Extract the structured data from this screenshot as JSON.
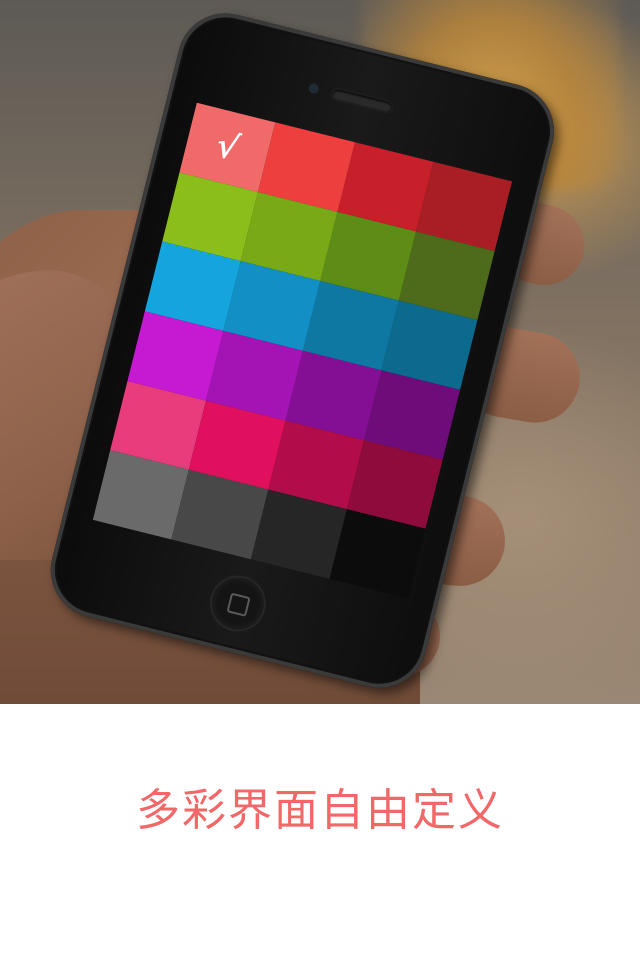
{
  "caption": {
    "text": "多彩界面自由定义",
    "color": "#f26767"
  },
  "phone": {
    "selected_mark": "√",
    "palette": [
      [
        "#f16a6a",
        "#ee3f3f",
        "#c8202a",
        "#a81e24"
      ],
      [
        "#8bbd1b",
        "#79a917",
        "#5e8d17",
        "#4d6b1a"
      ],
      [
        "#14a5df",
        "#1290c6",
        "#0f78a2",
        "#0d6a8f"
      ],
      [
        "#c619d2",
        "#a414b4",
        "#850f94",
        "#6e0c79"
      ],
      [
        "#e83c7c",
        "#e0105e",
        "#b30c4a",
        "#8f0b3c"
      ],
      [
        "#6a6a6a",
        "#484848",
        "#262626",
        "#0c0c0c"
      ]
    ],
    "selected_cell": [
      0,
      0
    ]
  }
}
